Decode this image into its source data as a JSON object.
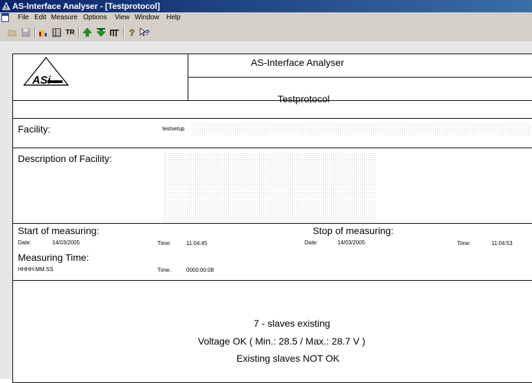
{
  "window": {
    "title": "AS-Interface Analyser - [Testprotocol]"
  },
  "menu": [
    "File",
    "Edit",
    "Measure",
    "Options",
    "View",
    "Window",
    "Help"
  ],
  "toolbar": {
    "tr_label": "TR",
    "buttons": [
      "open-icon",
      "save-icon",
      "chart-icon",
      "table-icon",
      "tr-icon",
      "up-arrow-icon",
      "down-arrow-icon",
      "trigger-icon",
      "help-icon",
      "whats-this-icon"
    ]
  },
  "protocol": {
    "header": "AS-Interface Analyser",
    "title": "Testprotocol",
    "logo_text": "ASi",
    "facility_label": "Facility:",
    "facility_value": "testsetup",
    "description_label": "Description of Facility:",
    "start_label": "Start of measuring:",
    "start_date_label": "Date:",
    "start_date": "14/03/2005",
    "start_time_label": "Time:",
    "start_time": "11:04:45",
    "stop_label": "Stop of measuring:",
    "stop_date_label": "Date:",
    "stop_date": "14/03/2005",
    "stop_time_label": "Time:",
    "stop_time": "11:04:53",
    "measuring_time_label": "Measuring Time:",
    "measuring_time_format": "HHHH:MM:SS",
    "measuring_time_time_label": "Time:",
    "measuring_time": "0000:00:08",
    "summary": [
      "7 - slaves existing",
      "Voltage OK ( Min.: 28.5 / Max.: 28.7 V )",
      "Existing slaves NOT OK"
    ]
  },
  "colors": {
    "titlebar_start": "#0a246a",
    "titlebar_end": "#3a6ea5",
    "chrome": "#d4d0c8"
  }
}
